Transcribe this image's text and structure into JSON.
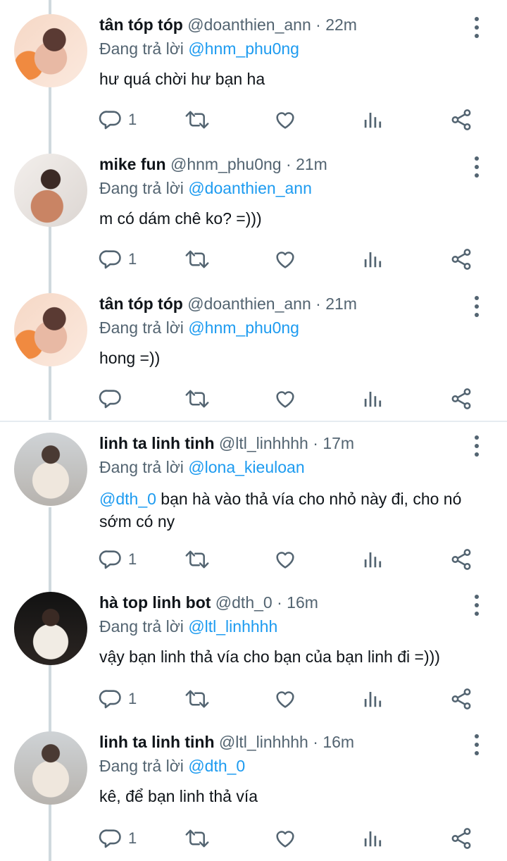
{
  "reply_prefix": "Đang trả lời",
  "tweets": [
    {
      "name": "tân tóp tóp",
      "handle": "@doanthien_ann",
      "time": "22m",
      "reply_to": "@hnm_phu0ng",
      "mention": "",
      "text": "hư quá chời hư bạn ha",
      "reply_count": "1"
    },
    {
      "name": "mike fun",
      "handle": "@hnm_phu0ng",
      "time": "21m",
      "reply_to": "@doanthien_ann",
      "mention": "",
      "text": "m có dám chê ko? =)))",
      "reply_count": "1"
    },
    {
      "name": "tân tóp tóp",
      "handle": "@doanthien_ann",
      "time": "21m",
      "reply_to": "@hnm_phu0ng",
      "mention": "",
      "text": "hong =))",
      "reply_count": ""
    },
    {
      "name": "linh ta linh tinh",
      "handle": "@ltl_linhhhh",
      "time": "17m",
      "reply_to": "@lona_kieuloan",
      "mention": "@dth_0",
      "text": " bạn hà vào thả vía cho nhỏ này đi, cho nó sớm có ny",
      "reply_count": "1"
    },
    {
      "name": "hà top linh bot",
      "handle": "@dth_0",
      "time": "16m",
      "reply_to": "@ltl_linhhhh",
      "mention": "",
      "text": "vậy bạn linh thả vía cho bạn của bạn linh đi =)))",
      "reply_count": "1"
    },
    {
      "name": "linh ta linh tinh",
      "handle": "@ltl_linhhhh",
      "time": "16m",
      "reply_to": "@dth_0",
      "mention": "",
      "text": "kê, để bạn linh thả vía",
      "reply_count": "1"
    }
  ],
  "icons": {
    "avatar": "avatar",
    "more": "more-icon",
    "reply": "reply-icon",
    "retweet": "retweet-icon",
    "like": "heart-icon",
    "views": "views-icon",
    "share": "share-icon"
  },
  "colors": {
    "link": "#1d9bf0",
    "muted": "#536471",
    "text": "#0f1419",
    "thread_line": "#cfd9de"
  }
}
